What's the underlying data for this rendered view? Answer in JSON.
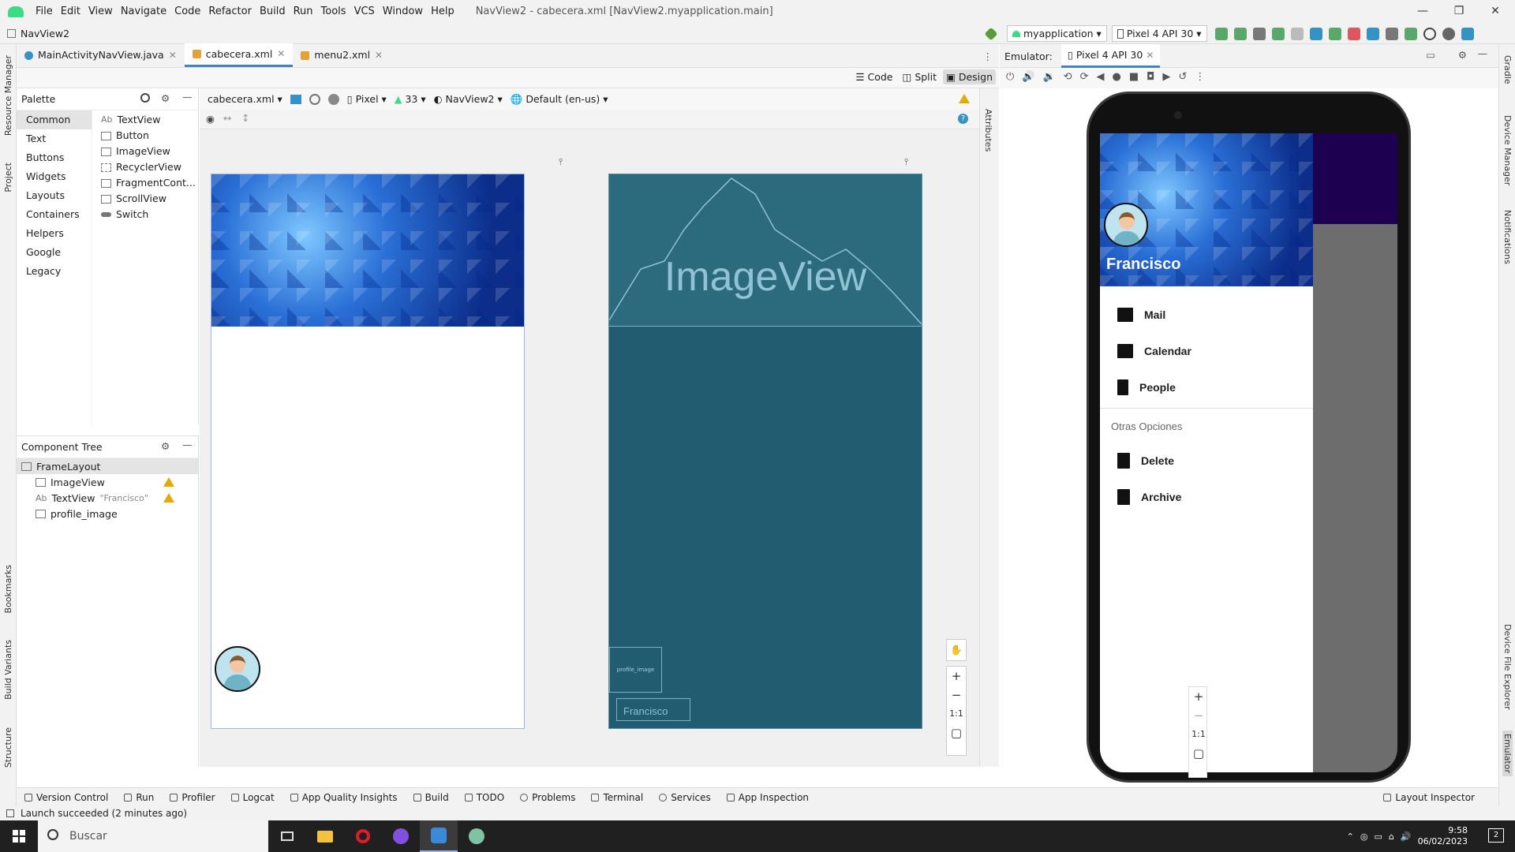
{
  "menu": [
    "File",
    "Edit",
    "View",
    "Navigate",
    "Code",
    "Refactor",
    "Build",
    "Run",
    "Tools",
    "VCS",
    "Window",
    "Help"
  ],
  "window_title": "NavView2 - cabecera.xml [NavView2.myapplication.main]",
  "window_controls": {
    "minimize": "—",
    "maximize": "❐",
    "close": "✕"
  },
  "breadcrumb": "NavView2",
  "run_config": "myapplication",
  "device_combo": "Pixel 4 API 30",
  "side_left": {
    "resource_manager": "Resource Manager",
    "project": "Project",
    "bookmarks": "Bookmarks",
    "build_variants": "Build Variants",
    "structure": "Structure"
  },
  "side_right": {
    "gradle": "Gradle",
    "device_manager": "Device Manager",
    "notifications": "Notifications",
    "device_file_explorer": "Device File Explorer",
    "emulator": "Emulator"
  },
  "editor_tabs": [
    "MainActivityNavView.java",
    "cabecera.xml",
    "menu2.xml"
  ],
  "view_modes": [
    "Code",
    "Split",
    "Design"
  ],
  "palette": {
    "title": "Palette",
    "categories": [
      "Common",
      "Text",
      "Buttons",
      "Widgets",
      "Layouts",
      "Containers",
      "Helpers",
      "Google",
      "Legacy"
    ],
    "items": [
      {
        "prefix": "Ab",
        "label": "TextView"
      },
      {
        "prefix": "",
        "label": "Button"
      },
      {
        "prefix": "",
        "label": "ImageView"
      },
      {
        "prefix": "",
        "label": "RecyclerView"
      },
      {
        "prefix": "",
        "label": "FragmentCont..."
      },
      {
        "prefix": "",
        "label": "ScrollView"
      },
      {
        "prefix": "",
        "label": "Switch"
      }
    ]
  },
  "design_toolbar": {
    "file": "cabecera.xml",
    "device": "Pixel",
    "api": "33",
    "theme": "NavView2",
    "locale": "Default (en-us)"
  },
  "component_tree": {
    "title": "Component Tree",
    "rows": [
      {
        "label": "FrameLayout",
        "extra": ""
      },
      {
        "label": "ImageView",
        "extra": ""
      },
      {
        "label": "TextView",
        "extra": "\"Francisco\""
      },
      {
        "label": "profile_image",
        "extra": ""
      }
    ]
  },
  "blueprint": {
    "imageview_label": "ImageView",
    "profile_label": "profile_image",
    "text_label": "Francisco"
  },
  "canvas_zoom": {
    "plus": "+",
    "minus": "−",
    "one": "1:1"
  },
  "attributes_label": "Attributes",
  "emulator": {
    "label": "Emulator:",
    "tab": "Pixel 4 API 30",
    "header_name": "Francisco",
    "nav_items": [
      "Mail",
      "Calendar",
      "People"
    ],
    "section_title": "Otras Opciones",
    "section_items": [
      "Delete",
      "Archive"
    ]
  },
  "bottom_tools": [
    "Version Control",
    "Run",
    "Profiler",
    "Logcat",
    "App Quality Insights",
    "Build",
    "TODO",
    "Problems",
    "Terminal",
    "Services",
    "App Inspection"
  ],
  "layout_inspector": "Layout Inspector",
  "status": "Launch succeeded (2 minutes ago)",
  "taskbar": {
    "search_placeholder": "Buscar",
    "time": "9:58",
    "date": "06/02/2023",
    "notif_count": "2"
  }
}
